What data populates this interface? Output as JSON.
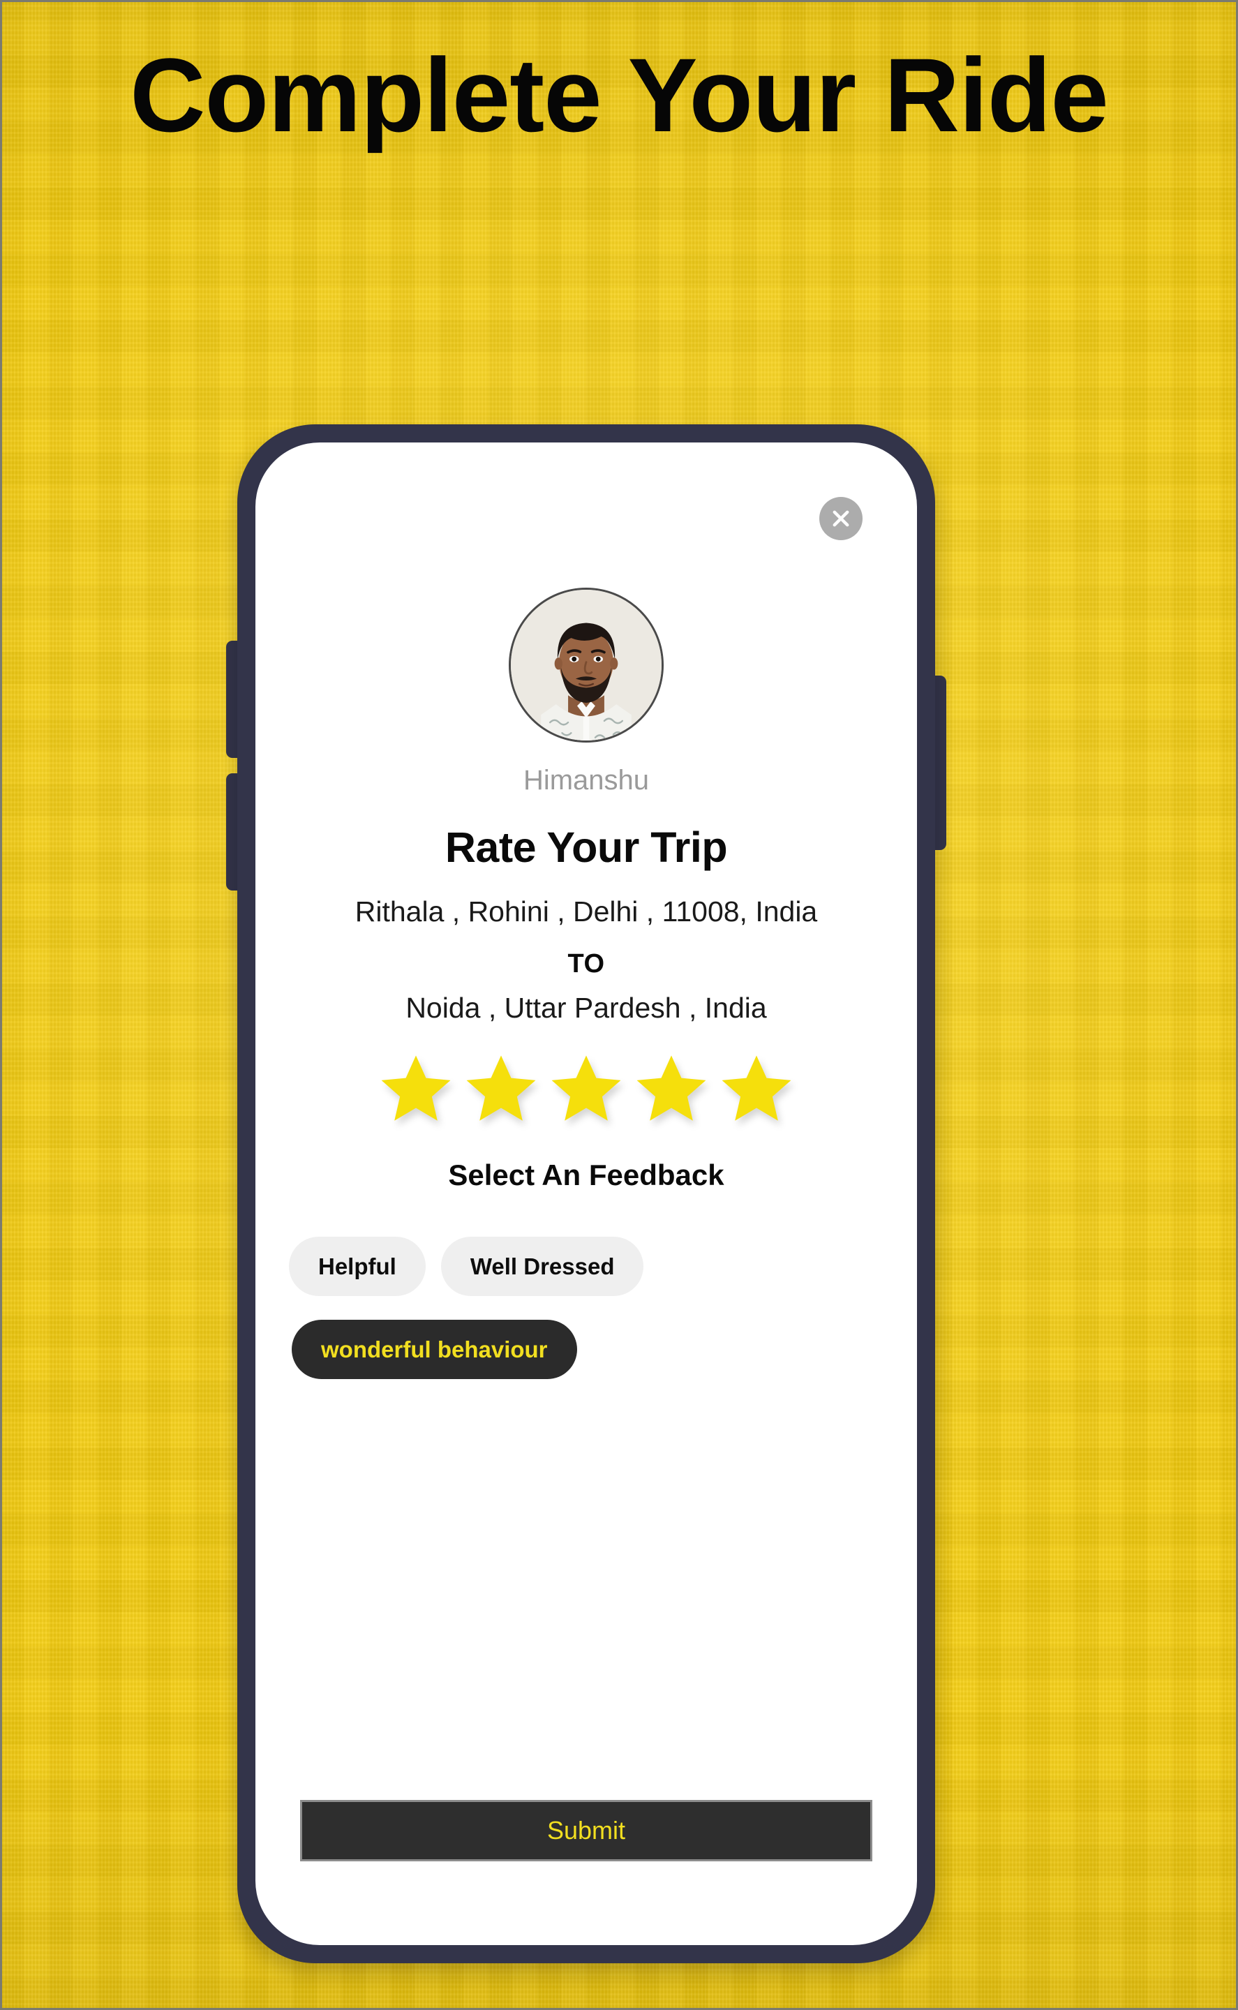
{
  "poster": {
    "headline": "Complete Your Ride",
    "background_color": "#F5CD0E"
  },
  "phone": {
    "frame_color": "#33344A",
    "screen_background": "#FFFFFF",
    "hardware_buttons": [
      "volume-up",
      "volume-down",
      "power"
    ]
  },
  "screen": {
    "close_button": {
      "icon": "close-icon",
      "color": "#ACACAC"
    },
    "driver": {
      "avatar_alt": "driver-photo",
      "name": "Himanshu"
    },
    "rate_title": "Rate Your Trip",
    "trip": {
      "from": "Rithala , Rohini , Delhi , 11008, India",
      "to_label": "TO",
      "to": "Noida , Uttar Pardesh , India"
    },
    "rating": {
      "value": 5,
      "max": 5,
      "star_color": "#F5DF0C"
    },
    "feedback": {
      "title": "Select An Feedback",
      "options": [
        {
          "label": "Helpful",
          "selected": false
        },
        {
          "label": "Well Dressed",
          "selected": false
        },
        {
          "label": "wonderful behaviour",
          "selected": true
        }
      ],
      "chip_bg": "#EFEFEF",
      "chip_selected_bg": "#2B2B2B",
      "chip_selected_text": "#F2DF20"
    },
    "submit": {
      "label": "Submit",
      "bg": "#2E2E2E",
      "text_color": "#F2DF20"
    }
  }
}
